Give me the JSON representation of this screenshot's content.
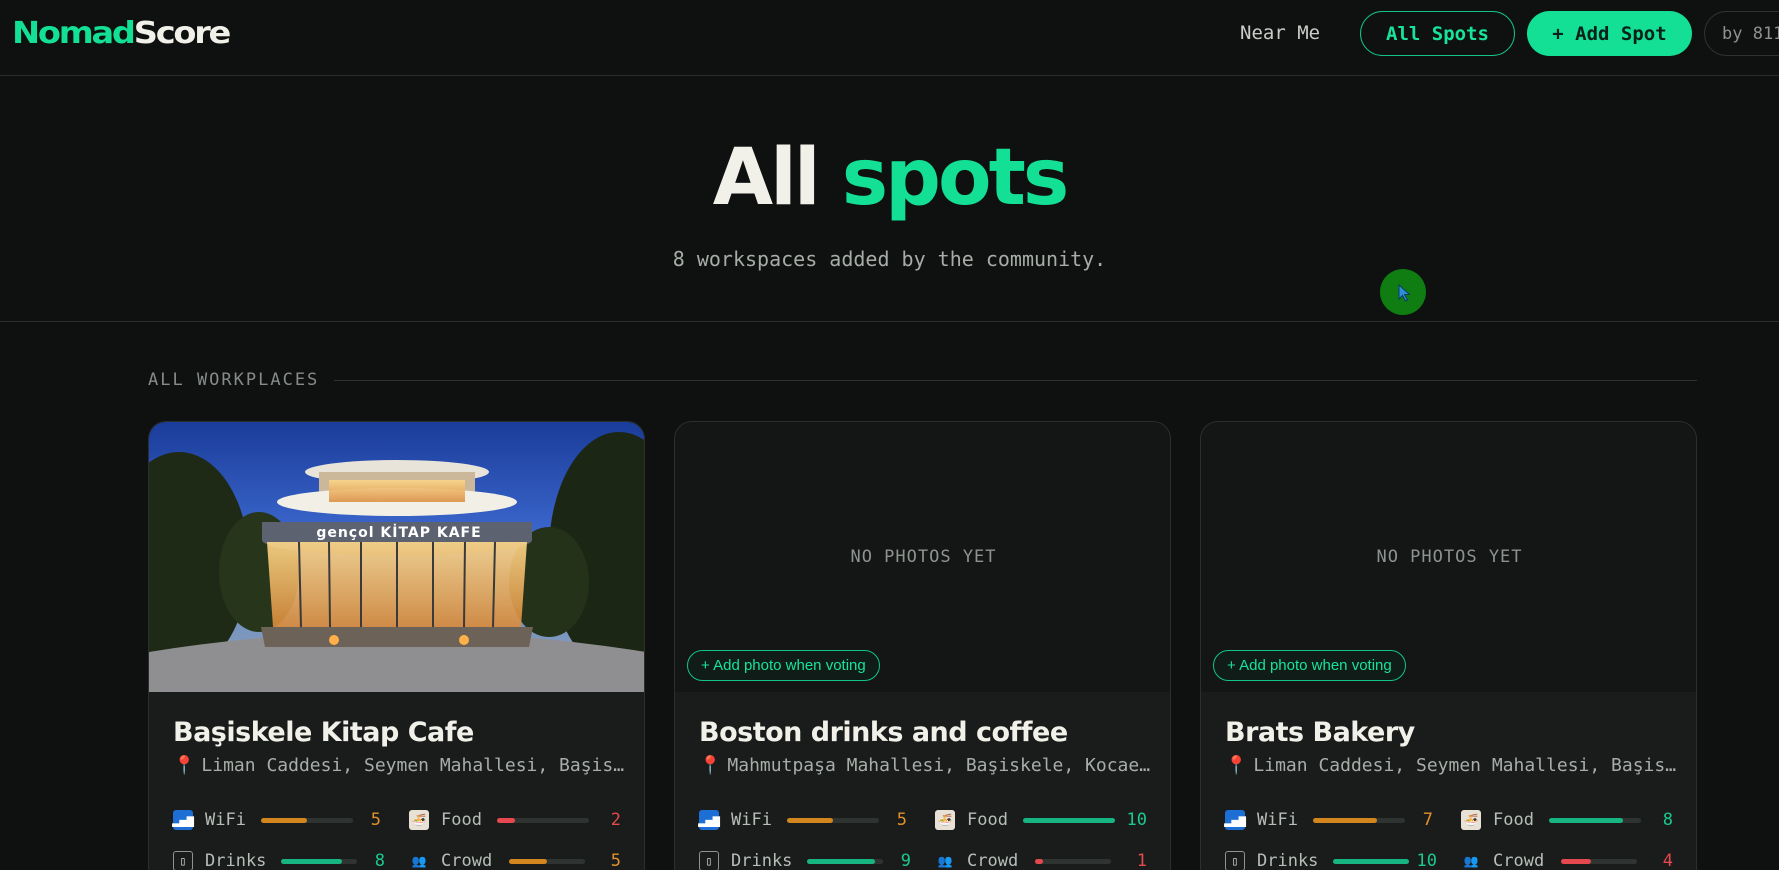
{
  "brand": {
    "part1": "Nomad",
    "part2": "Score"
  },
  "nav": {
    "near_me": "Near Me",
    "all_spots": "All Spots",
    "add_spot": "+ Add Spot",
    "by": "by 811"
  },
  "hero": {
    "title_word1": "All",
    "title_word2": "spots",
    "subtitle": "8 workspaces added by the community."
  },
  "section": {
    "label": "ALL WORKPLACES"
  },
  "cards": [
    {
      "title": "Başiskele Kitap Cafe",
      "address": "Liman Caddesi, Seymen Mahallesi, Başiskele, Kocaeli",
      "has_photo": true,
      "photo_sign": "gençol KİTAP KAFE",
      "stats": [
        {
          "label": "WiFi",
          "icon": "wifi-icon",
          "value": "5",
          "fraction": 0.5,
          "color": "#d2861d"
        },
        {
          "label": "Food",
          "icon": "food-icon",
          "value": "2",
          "fraction": 0.2,
          "color": "#e5484d"
        },
        {
          "label": "Drinks",
          "icon": "drinks-icon",
          "value": "8",
          "fraction": 0.8,
          "color": "#17b582"
        },
        {
          "label": "Crowd",
          "icon": "crowd-icon",
          "value": "5",
          "fraction": 0.5,
          "color": "#d2861d"
        }
      ]
    },
    {
      "title": "Boston drinks and coffee",
      "address": "Mahmutpaşa Mahallesi, Başiskele, Kocaeli",
      "has_photo": false,
      "no_photos_text": "NO PHOTOS YET",
      "add_photo_text": "+ Add photo when voting",
      "stats": [
        {
          "label": "WiFi",
          "icon": "wifi-icon",
          "value": "5",
          "fraction": 0.5,
          "color": "#d2861d"
        },
        {
          "label": "Food",
          "icon": "food-icon",
          "value": "10",
          "fraction": 1.0,
          "color": "#17b582"
        },
        {
          "label": "Drinks",
          "icon": "drinks-icon",
          "value": "9",
          "fraction": 0.9,
          "color": "#17b582"
        },
        {
          "label": "Crowd",
          "icon": "crowd-icon",
          "value": "1",
          "fraction": 0.1,
          "color": "#e5484d"
        }
      ]
    },
    {
      "title": "Brats Bakery",
      "address": "Liman Caddesi, Seymen Mahallesi, Başiskele, Kocaeli",
      "has_photo": false,
      "no_photos_text": "NO PHOTOS YET",
      "add_photo_text": "+ Add photo when voting",
      "stats": [
        {
          "label": "WiFi",
          "icon": "wifi-icon",
          "value": "7",
          "fraction": 0.7,
          "color": "#d2861d"
        },
        {
          "label": "Food",
          "icon": "food-icon",
          "value": "8",
          "fraction": 0.8,
          "color": "#17b582"
        },
        {
          "label": "Drinks",
          "icon": "drinks-icon",
          "value": "10",
          "fraction": 1.0,
          "color": "#17b582"
        },
        {
          "label": "Crowd",
          "icon": "crowd-icon",
          "value": "4",
          "fraction": 0.4,
          "color": "#e5484d"
        }
      ]
    }
  ]
}
